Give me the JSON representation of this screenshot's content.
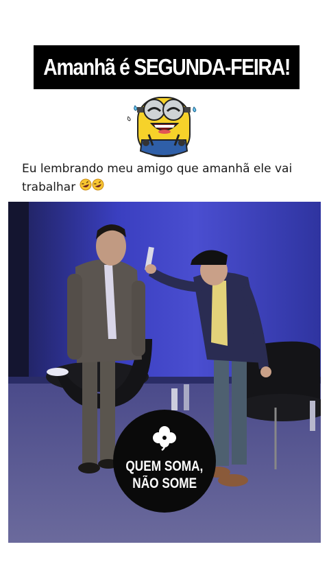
{
  "banner": {
    "title": "Amanhã é SEGUNDA-FEIRA!"
  },
  "emoji": {
    "icon": "laughing-minion-icon"
  },
  "caption": {
    "text": "Eu lembrando meu amigo que amanhã ele vai trabalhar",
    "emoji_icon": "rolling-on-floor-laughing-icon"
  },
  "video": {
    "scene": "video-frame"
  },
  "badge": {
    "icon": "clover-icon",
    "line1": "QUEM SOMA,",
    "line2": "NÃO SOME"
  },
  "colors": {
    "banner_bg": "#000000",
    "banner_text": "#ffffff",
    "stage_blue": "#2e36a8",
    "badge_bg": "#0a0a0a"
  }
}
